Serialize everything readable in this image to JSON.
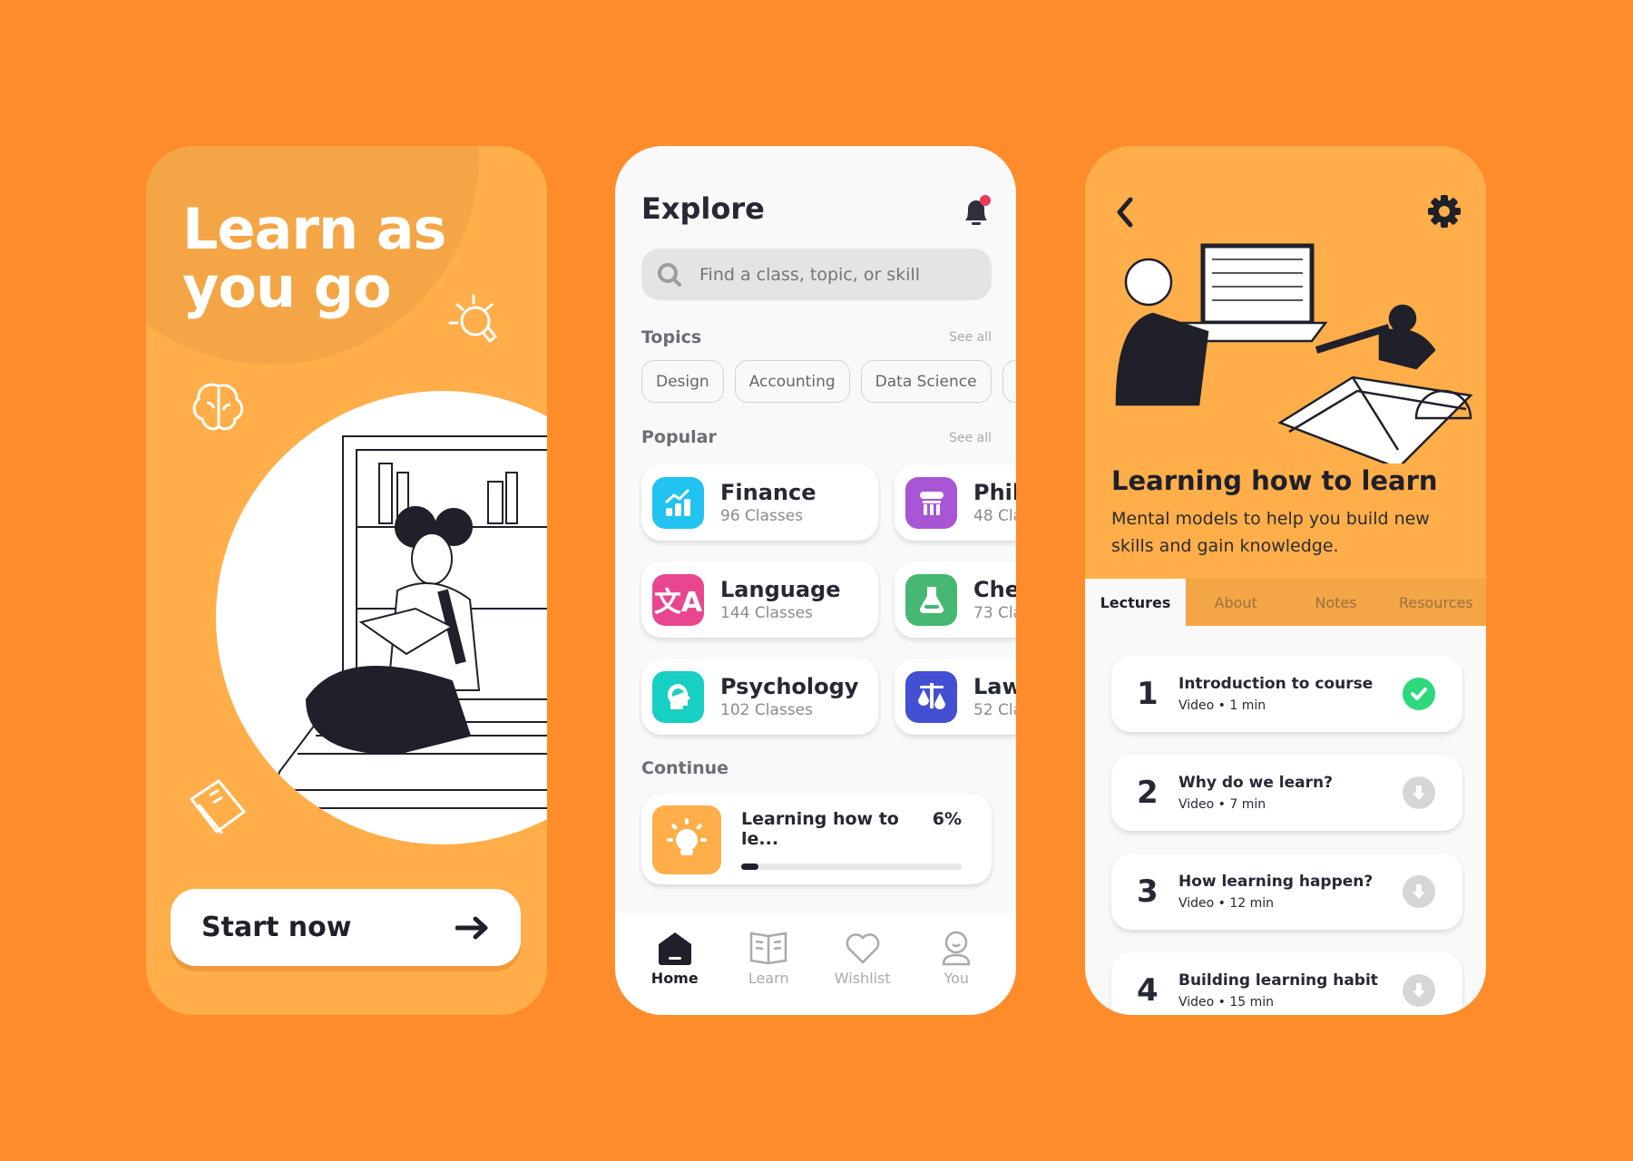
{
  "colors": {
    "background": "#FF8C2B",
    "accent": "#FFAE4A",
    "dark": "#1F2029",
    "done": "#2FD87C",
    "notification": "#EB3B5A"
  },
  "onboarding": {
    "title": "Learn as you go",
    "start_label": "Start now"
  },
  "explore": {
    "title": "Explore",
    "search_placeholder": "Find a class, topic, or skill",
    "topics_label": "Topics",
    "topics_see_all": "See all",
    "topics": [
      "Design",
      "Accounting",
      "Data Science"
    ],
    "popular_label": "Popular",
    "popular_see_all": "See all",
    "popular": [
      {
        "name": "Finance",
        "count": "96 Classes",
        "icon": "chart-growth-icon",
        "color": "#22C3F0"
      },
      {
        "name": "Phil",
        "count": "48 Cla",
        "icon": "column-icon",
        "color": "#A855D6"
      },
      {
        "name": "Language",
        "count": "144 Classes",
        "icon": "translate-icon",
        "color": "#E8478F"
      },
      {
        "name": "Che",
        "count": "73 Cla",
        "icon": "flask-icon",
        "color": "#46B874"
      },
      {
        "name": "Psychology",
        "count": "102 Classes",
        "icon": "head-icon",
        "color": "#17CFC2"
      },
      {
        "name": "Law",
        "count": "52 Cla",
        "icon": "scales-icon",
        "color": "#4350D3"
      }
    ],
    "continue_label": "Continue",
    "continue": {
      "title": "Learning how to le...",
      "progress_text": "6%",
      "progress": 0.06
    },
    "nav": [
      {
        "label": "Home",
        "active": true
      },
      {
        "label": "Learn"
      },
      {
        "label": "Wishlist"
      },
      {
        "label": "You"
      }
    ]
  },
  "course": {
    "title": "Learning how to learn",
    "description": "Mental models to help you build new skills and gain knowledge.",
    "tabs": [
      "Lectures",
      "About",
      "Notes",
      "Resources"
    ],
    "active_tab": "Lectures",
    "lectures": [
      {
        "num": "1",
        "title": "Introduction to course",
        "meta": "Video • 1 min",
        "status": "completed"
      },
      {
        "num": "2",
        "title": "Why do we learn?",
        "meta": "Video • 7 min",
        "status": "download"
      },
      {
        "num": "3",
        "title": "How learning happen?",
        "meta": "Video • 12 min",
        "status": "download"
      },
      {
        "num": "4",
        "title": "Building learning habit",
        "meta": "Video • 15 min",
        "status": "download"
      }
    ]
  }
}
